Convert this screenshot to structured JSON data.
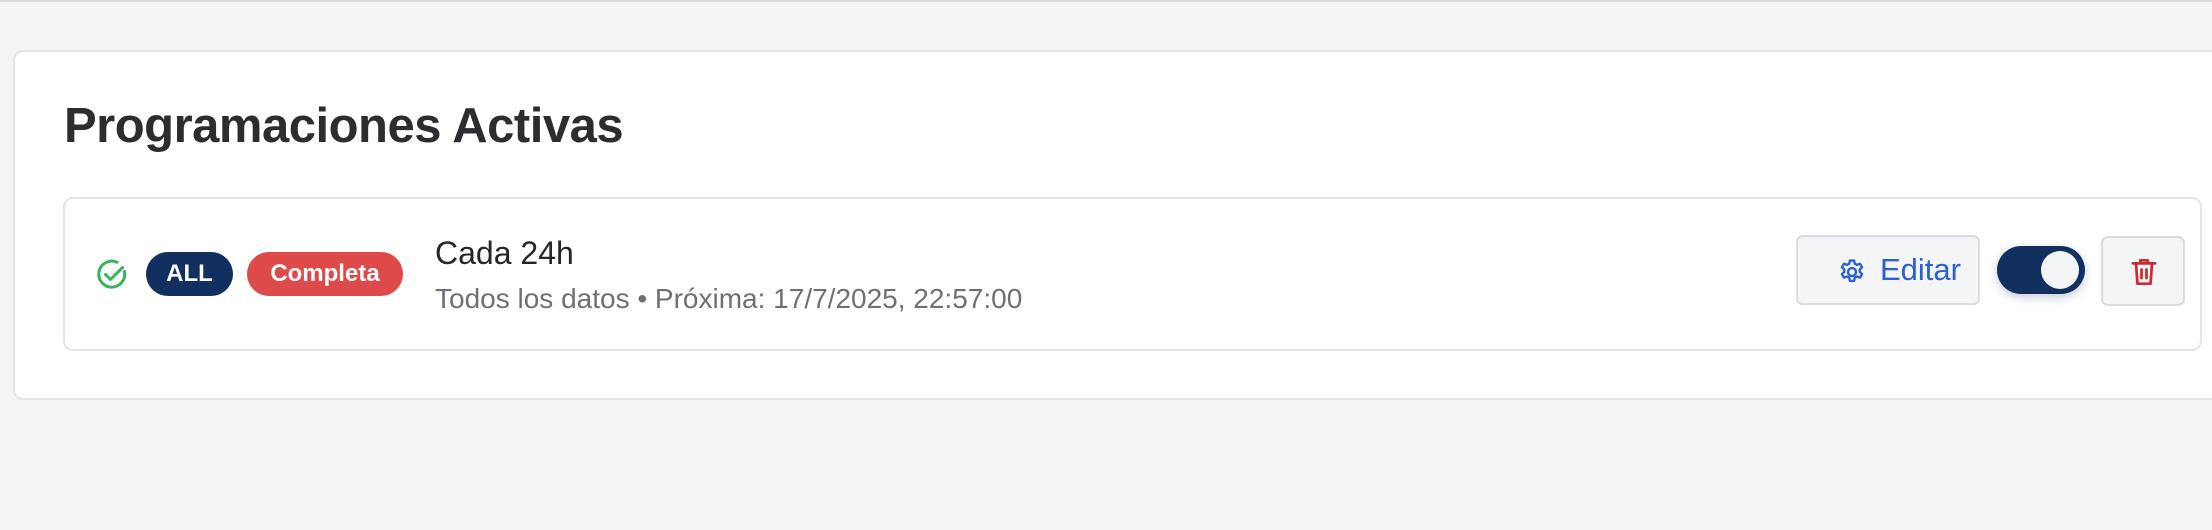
{
  "panel": {
    "title": "Programaciones Activas"
  },
  "schedules": [
    {
      "status_icon": "check-circle-icon",
      "type_badge": "ALL",
      "mode_badge": "Completa",
      "title": "Cada 24h",
      "subtitle": "Todos los datos • Próxima: 17/7/2025, 22:57:00",
      "edit_label": "Editar",
      "edit_icon": "gear-icon",
      "enabled": true,
      "delete_icon": "trash-icon"
    }
  ],
  "colors": {
    "background": "#f3f4f6",
    "navy": "#12305f",
    "complete_badge": "#de4a4a",
    "success": "#34b45a",
    "link_blue": "#2c5fd2",
    "danger": "#c72d2d"
  }
}
